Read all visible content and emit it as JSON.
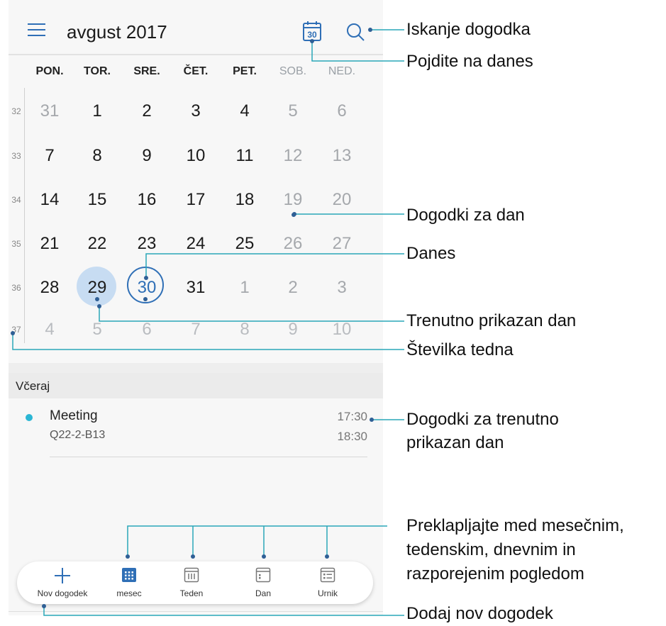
{
  "header": {
    "month_title": "avgust 2017",
    "today_icon_number": "30"
  },
  "weekdays": [
    "PON.",
    "TOR.",
    "SRE.",
    "ČET.",
    "PET.",
    "SOB.",
    "NED."
  ],
  "weeks": [
    {
      "num": "32",
      "days": [
        "31",
        "1",
        "2",
        "3",
        "4",
        "5",
        "6"
      ]
    },
    {
      "num": "33",
      "days": [
        "7",
        "8",
        "9",
        "10",
        "11",
        "12",
        "13"
      ]
    },
    {
      "num": "34",
      "days": [
        "14",
        "15",
        "16",
        "17",
        "18",
        "19",
        "20"
      ]
    },
    {
      "num": "35",
      "days": [
        "21",
        "22",
        "23",
        "24",
        "25",
        "26",
        "27"
      ]
    },
    {
      "num": "36",
      "days": [
        "28",
        "29",
        "30",
        "31",
        "1",
        "2",
        "3"
      ]
    },
    {
      "num": "37",
      "days": [
        "4",
        "5",
        "6",
        "7",
        "8",
        "9",
        "10"
      ]
    }
  ],
  "selected_day": "29",
  "today": "30",
  "agenda": {
    "section_label": "Včeraj",
    "events": [
      {
        "title": "Meeting",
        "location": "Q22-2-B13",
        "start": "17:30",
        "end": "18:30"
      }
    ]
  },
  "bottom_nav": {
    "new_event": "Nov dogodek",
    "month": "mesec",
    "week": "Teden",
    "day": "Dan",
    "schedule": "Urnik"
  },
  "callouts": {
    "search": "Iskanje dogodka",
    "go_today": "Pojdite na danes",
    "events_for_day": "Dogodki za dan",
    "today": "Danes",
    "current_day": "Trenutno prikazan dan",
    "week_number": "Številka tedna",
    "events_current_line1": "Dogodki za trenutno",
    "events_current_line2": "prikazan dan",
    "switch_line1": "Preklapljajte med mesečnim,",
    "switch_line2": "tedenskim, dnevnim in",
    "switch_line3": "razporejenim pogledom",
    "add_event": "Dodaj nov dogodek"
  },
  "colors": {
    "accent": "#2f6fb6",
    "selected_fill": "#c7dcf2",
    "event_dot": "#2bb6d4",
    "callout_line": "#2aa7b8"
  }
}
